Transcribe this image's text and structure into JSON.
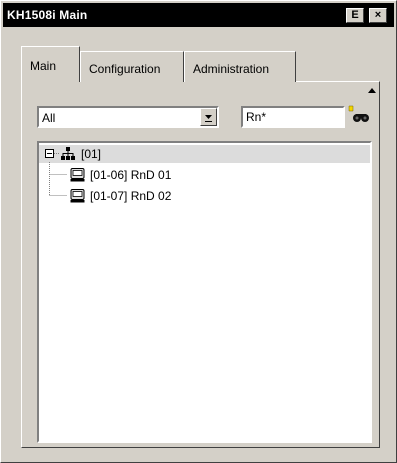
{
  "window": {
    "title": "KH1508i Main",
    "ex_button": "E",
    "close_button": "×"
  },
  "tabs": [
    {
      "label": "Main",
      "active": true
    },
    {
      "label": "Configuration",
      "active": false
    },
    {
      "label": "Administration",
      "active": false
    }
  ],
  "filter": {
    "selected": "All"
  },
  "search": {
    "value": "Rn*"
  },
  "tree": {
    "root": {
      "label": "[01]",
      "icon": "network-tree-icon"
    },
    "children": [
      {
        "label": "[01-06] RnD 01",
        "icon": "computer-icon"
      },
      {
        "label": "[01-07] RnD 02",
        "icon": "computer-icon"
      }
    ]
  }
}
